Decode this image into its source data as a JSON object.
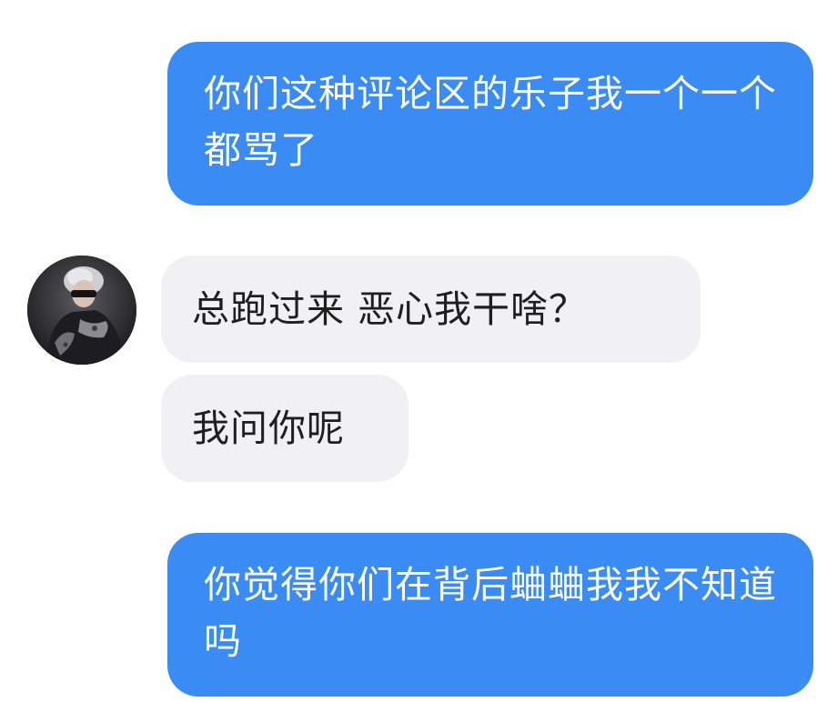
{
  "colors": {
    "outgoing_bubble": "#3a8bf3",
    "incoming_bubble": "#f1f1f3",
    "outgoing_text": "#ffffff",
    "incoming_text": "#1f1f1f"
  },
  "messages": [
    {
      "direction": "outgoing",
      "text": "你们这种评论区的乐子我一个一个都骂了"
    },
    {
      "direction": "incoming",
      "text": "总跑过来 恶心我干啥？"
    },
    {
      "direction": "incoming",
      "text": "我问你呢"
    },
    {
      "direction": "outgoing",
      "text": "你觉得你们在背后蛐蛐我我不知道吗"
    }
  ],
  "contact": {
    "avatar_icon": "user-photo-avatar"
  }
}
